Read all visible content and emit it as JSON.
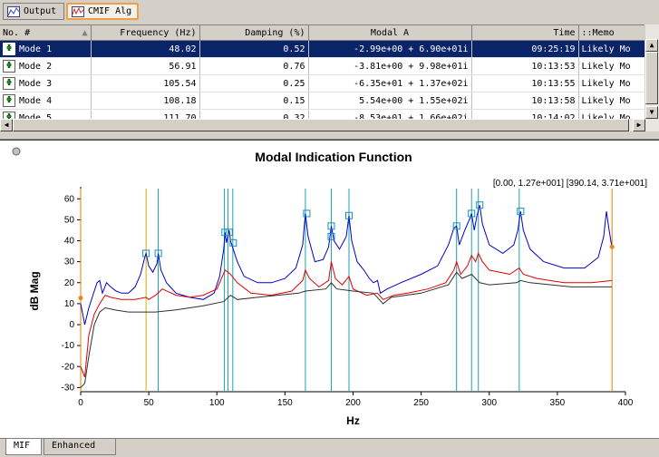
{
  "tabs": [
    {
      "label": "Output",
      "active": false
    },
    {
      "label": "CMIF Alg",
      "active": true
    }
  ],
  "table": {
    "columns": [
      "No. #",
      "Frequency (Hz)",
      "Damping (%)",
      "Modal A",
      "Time",
      "::Memo"
    ],
    "rows": [
      {
        "name": "Mode  1",
        "freq": "48.02",
        "damp": "0.52",
        "modal": "-2.99e+00 + 6.90e+01i",
        "time": "09:25:19",
        "memo": "Likely Mo",
        "selected": true
      },
      {
        "name": "Mode  2",
        "freq": "56.91",
        "damp": "0.76",
        "modal": "-3.81e+00 + 9.98e+01i",
        "time": "10:13:53",
        "memo": "Likely Mo",
        "selected": false
      },
      {
        "name": "Mode  3",
        "freq": "105.54",
        "damp": "0.25",
        "modal": "-6.35e+01 + 1.37e+02i",
        "time": "10:13:55",
        "memo": "Likely Mo",
        "selected": false
      },
      {
        "name": "Mode  4",
        "freq": "108.18",
        "damp": "0.15",
        "modal": "5.54e+00 + 1.55e+02i",
        "time": "10:13:58",
        "memo": "Likely Mo",
        "selected": false
      },
      {
        "name": "Mode  5",
        "freq": "111.70",
        "damp": "0.32",
        "modal": "-8.53e+01 + 1.66e+02i",
        "time": "10:14:02",
        "memo": "Likely Mo",
        "selected": false
      }
    ]
  },
  "plot": {
    "title": "Modal Indication Function",
    "cursor_readout": "[0.00, 1.27e+001] [390.14, 3.71e+001]"
  },
  "bottom_tabs": [
    {
      "label": "MIF",
      "active": true
    },
    {
      "label": "Enhanced",
      "active": false
    }
  ],
  "chart_data": {
    "type": "line",
    "title": "Modal Indication Function",
    "xlabel": "Hz",
    "ylabel": "dB Mag",
    "xlim": [
      0,
      400
    ],
    "ylim": [
      -32,
      64
    ],
    "xticks": [
      0,
      50,
      100,
      150,
      200,
      250,
      300,
      350,
      400
    ],
    "yticks": [
      -30,
      -20,
      -10,
      0,
      10,
      20,
      30,
      40,
      50,
      60
    ],
    "grid": false,
    "cursor_lines": [
      {
        "x": 0,
        "color": "#e08000"
      },
      {
        "x": 390.14,
        "color": "#e08000"
      }
    ],
    "cursor_points": [
      {
        "x": 0,
        "y": 12.7
      },
      {
        "x": 390.14,
        "y": 37.1
      }
    ],
    "mode_lines": [
      {
        "x": 48.02,
        "color": "#c8b400"
      },
      {
        "x": 56.91,
        "color": "#20a0b0"
      },
      {
        "x": 105.54,
        "color": "#20a0b0"
      },
      {
        "x": 108.18,
        "color": "#20a0b0"
      },
      {
        "x": 111.7,
        "color": "#20a0b0"
      },
      {
        "x": 165,
        "color": "#20a0b0"
      },
      {
        "x": 184,
        "color": "#20a0b0"
      },
      {
        "x": 197,
        "color": "#20a0b0"
      },
      {
        "x": 276,
        "color": "#20a0b0"
      },
      {
        "x": 287,
        "color": "#20a0b0"
      },
      {
        "x": 292,
        "color": "#20a0b0"
      },
      {
        "x": 322,
        "color": "#20a0b0"
      }
    ],
    "markers": [
      {
        "x": 48,
        "y": 34
      },
      {
        "x": 57,
        "y": 34
      },
      {
        "x": 106,
        "y": 44
      },
      {
        "x": 109,
        "y": 44
      },
      {
        "x": 112,
        "y": 39
      },
      {
        "x": 166,
        "y": 53
      },
      {
        "x": 184,
        "y": 47
      },
      {
        "x": 184,
        "y": 42
      },
      {
        "x": 197,
        "y": 52
      },
      {
        "x": 276,
        "y": 47
      },
      {
        "x": 287,
        "y": 53
      },
      {
        "x": 293,
        "y": 57
      },
      {
        "x": 323,
        "y": 54
      }
    ],
    "series": [
      {
        "color": "#0000cc",
        "x": [
          0,
          3,
          6,
          9,
          12,
          14,
          16,
          19,
          22,
          26,
          30,
          35,
          40,
          44,
          47,
          48,
          50,
          53,
          56,
          57,
          59,
          63,
          70,
          80,
          90,
          98,
          102,
          105,
          106,
          107,
          108,
          109,
          110,
          112,
          115,
          120,
          130,
          140,
          150,
          158,
          163,
          165,
          167,
          172,
          178,
          182,
          184,
          186,
          190,
          195,
          197,
          199,
          203,
          208,
          212,
          215,
          218,
          220,
          225,
          235,
          250,
          262,
          270,
          274,
          276,
          278,
          282,
          286,
          287,
          289,
          291,
          293,
          295,
          300,
          310,
          318,
          321,
          323,
          325,
          330,
          340,
          355,
          370,
          380,
          384,
          386,
          388,
          390
        ],
        "y": [
          10,
          0,
          8,
          14,
          20,
          21,
          15,
          20,
          18,
          16,
          15,
          15,
          18,
          24,
          32,
          34,
          28,
          25,
          29,
          34,
          26,
          20,
          15,
          13,
          12,
          15,
          23,
          36,
          44,
          39,
          42,
          45,
          40,
          36,
          30,
          23,
          20,
          20,
          22,
          27,
          38,
          53,
          42,
          30,
          31,
          37,
          47,
          40,
          36,
          42,
          52,
          40,
          30,
          26,
          22,
          20,
          21,
          15,
          17,
          20,
          24,
          28,
          38,
          46,
          47,
          38,
          45,
          51,
          53,
          45,
          52,
          57,
          48,
          38,
          34,
          38,
          45,
          54,
          45,
          36,
          30,
          27,
          27,
          32,
          42,
          54,
          45,
          37
        ]
      },
      {
        "color": "#e00000",
        "x": [
          0,
          3,
          6,
          10,
          14,
          18,
          22,
          30,
          40,
          48,
          50,
          55,
          60,
          70,
          80,
          90,
          100,
          106,
          108,
          110,
          115,
          125,
          140,
          155,
          163,
          165,
          168,
          175,
          182,
          184,
          187,
          192,
          197,
          200,
          210,
          218,
          222,
          230,
          240,
          255,
          268,
          274,
          276,
          279,
          284,
          287,
          290,
          292,
          295,
          300,
          315,
          322,
          325,
          335,
          355,
          375,
          390
        ],
        "y": [
          -20,
          -25,
          -5,
          5,
          10,
          14,
          13,
          12,
          12,
          13,
          12,
          14,
          17,
          14,
          13,
          14,
          17,
          26,
          25,
          24,
          20,
          15,
          14,
          16,
          21,
          26,
          22,
          18,
          21,
          30,
          22,
          19,
          23,
          17,
          14,
          15,
          12,
          14,
          15,
          17,
          20,
          26,
          30,
          24,
          28,
          33,
          30,
          34,
          30,
          26,
          24,
          27,
          24,
          22,
          20,
          20,
          21
        ]
      },
      {
        "color": "#303030",
        "x": [
          0,
          3,
          6,
          10,
          14,
          18,
          25,
          35,
          45,
          55,
          70,
          90,
          105,
          110,
          115,
          130,
          160,
          165,
          180,
          184,
          188,
          200,
          215,
          222,
          228,
          250,
          270,
          276,
          280,
          287,
          293,
          300,
          320,
          323,
          330,
          360,
          390
        ],
        "y": [
          -30,
          -28,
          -15,
          0,
          6,
          8,
          7,
          6,
          6,
          6,
          7,
          9,
          11,
          14,
          12,
          13,
          15,
          16,
          17,
          20,
          17,
          16,
          15,
          10,
          13,
          15,
          19,
          25,
          22,
          24,
          20,
          19,
          20,
          21,
          20,
          18,
          18
        ]
      }
    ]
  }
}
